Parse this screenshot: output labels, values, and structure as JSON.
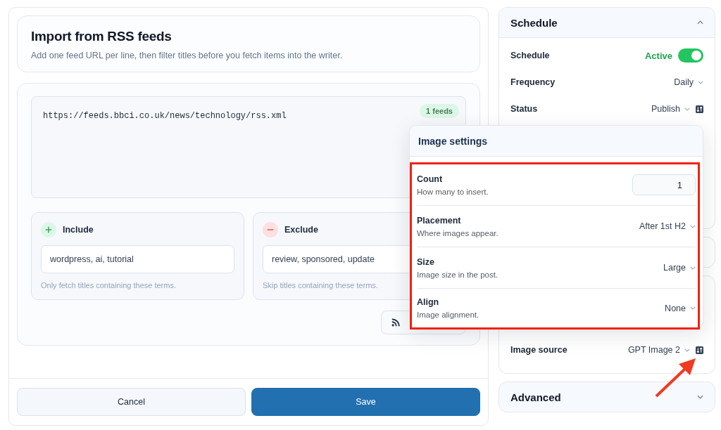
{
  "import": {
    "title": "Import from RSS feeds",
    "description": "Add one feed URL per line, then filter titles before you fetch items into the writer.",
    "feeds_text": "https://feeds.bbci.co.uk/news/technology/rss.xml",
    "feed_count": "1 feeds",
    "filters": [
      {
        "kind": "include",
        "title": "Include",
        "value": "wordpress, ai, tutorial",
        "hint": "Only fetch titles containing these terms."
      },
      {
        "kind": "exclude",
        "title": "Exclude",
        "value": "review, sponsored, update",
        "hint": "Skip titles containing these terms."
      }
    ]
  },
  "footer": {
    "buttons": [
      {
        "label": "Cancel",
        "kind": "secondary"
      },
      {
        "label": "Save",
        "kind": "primary"
      }
    ]
  },
  "schedule": {
    "title": "Schedule",
    "expanded": true,
    "rows": [
      {
        "kind": "toggle",
        "label": "Schedule",
        "value": "Active",
        "on": true
      },
      {
        "kind": "select",
        "label": "Frequency",
        "value": "Daily",
        "sort_button": false
      },
      {
        "kind": "select",
        "label": "Status",
        "value": "Publish",
        "sort_button": true
      }
    ]
  },
  "image_source": {
    "label": "Image source",
    "value": "GPT Image 2",
    "sort_button": true
  },
  "advanced": {
    "title": "Advanced",
    "expanded": false
  },
  "image_settings": {
    "title": "Image settings",
    "highlighted": true,
    "rows": [
      {
        "kind": "number",
        "label": "Count",
        "hint": "How many to insert.",
        "value": "1"
      },
      {
        "kind": "select",
        "label": "Placement",
        "hint": "Where images appear.",
        "value": "After 1st H2"
      },
      {
        "kind": "select",
        "label": "Size",
        "hint": "Image size in the post.",
        "value": "Large"
      },
      {
        "kind": "select",
        "label": "Align",
        "hint": "Image alignment.",
        "value": "None"
      }
    ]
  }
}
